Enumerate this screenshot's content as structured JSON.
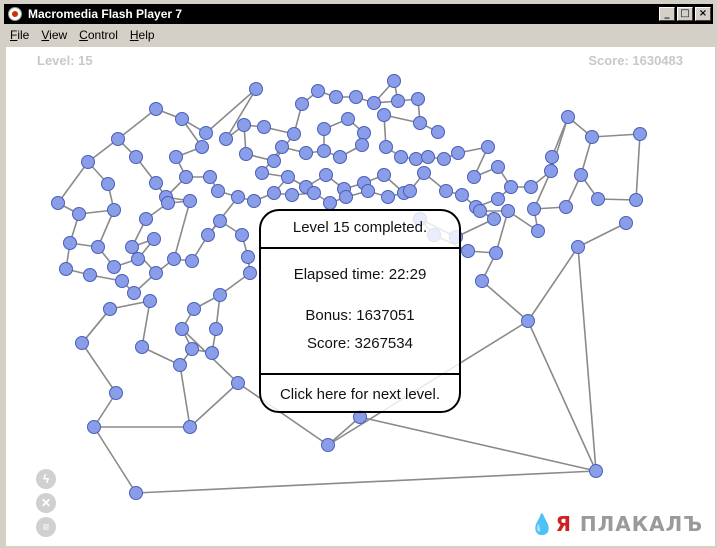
{
  "window": {
    "title": "Macromedia Flash Player 7",
    "buttons": {
      "minimize": "_",
      "maximize": "□",
      "close": "×"
    }
  },
  "menu": [
    {
      "label": "File"
    },
    {
      "label": "View"
    },
    {
      "label": "Control"
    },
    {
      "label": "Help"
    }
  ],
  "hud": {
    "level": "Level: 15",
    "score": "Score: 1630483"
  },
  "dialog": {
    "title": "Level 15 completed.",
    "elapsed": "Elapsed time: 22:29",
    "bonus": "Bonus: 1637051",
    "score": "Score: 3267534",
    "next": "Click here for next level."
  },
  "side_icons": [
    "lightning-icon",
    "close-icon",
    "document-icon"
  ],
  "watermark": {
    "drop": "💧",
    "ya": "Я",
    "rest": " ПЛАКАЛЪ"
  },
  "colors": {
    "node_fill": "#8a9de8",
    "node_stroke": "#4a5db8",
    "edge": "#8a8a8a",
    "hud_text": "#c8c8c8"
  }
}
